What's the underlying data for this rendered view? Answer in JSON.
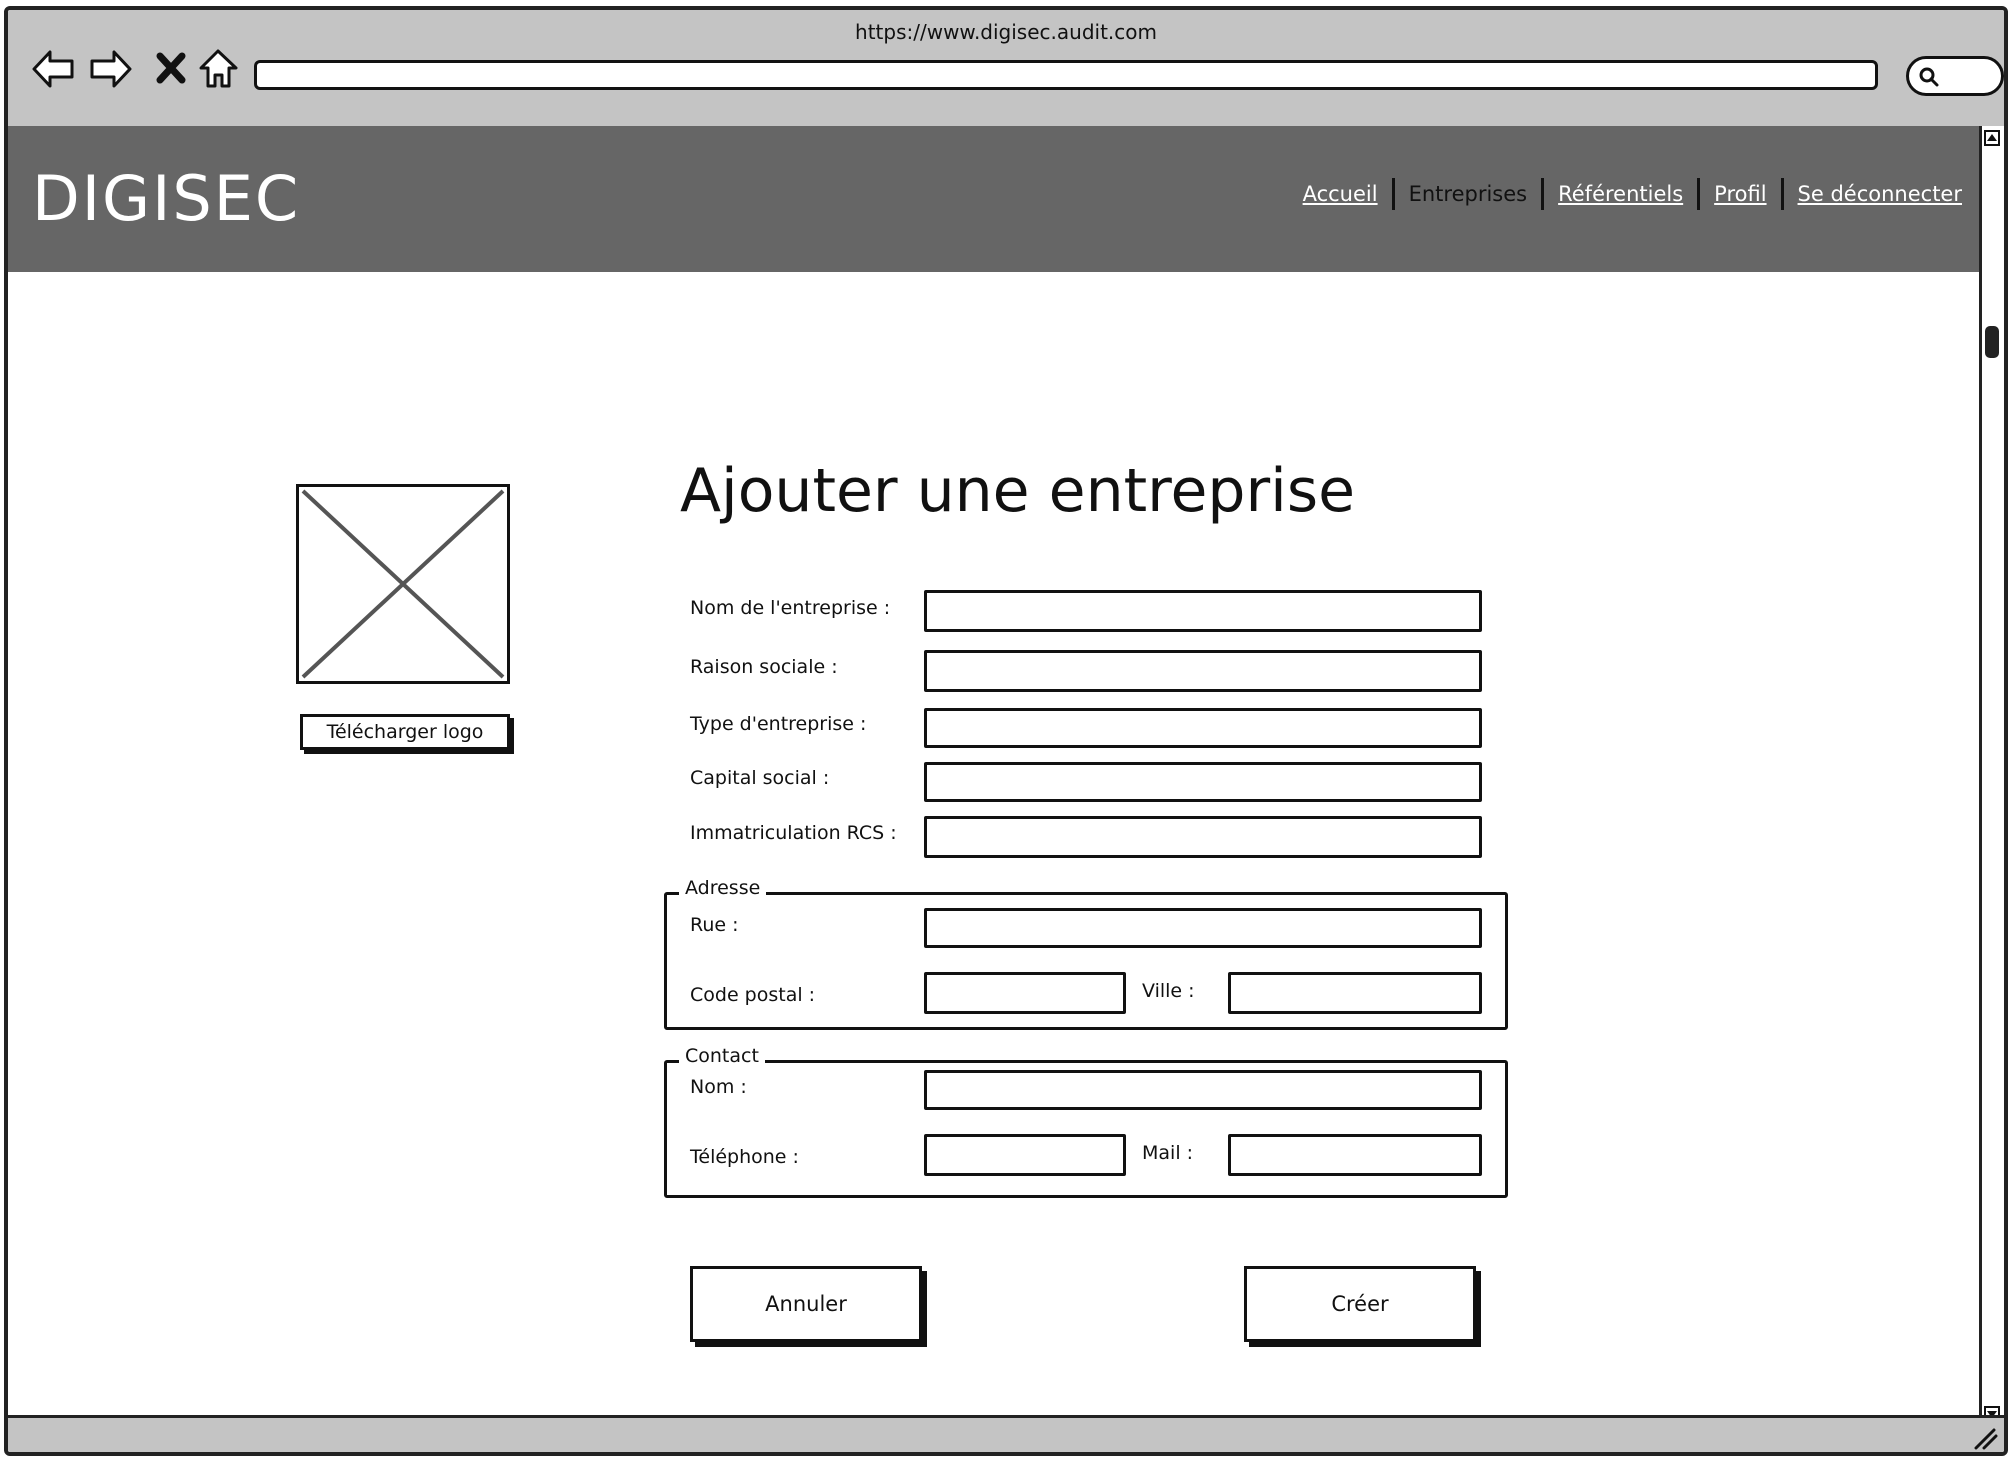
{
  "browser": {
    "url": "https://www.digisec.audit.com"
  },
  "header": {
    "logo": "DIGISEC",
    "nav": [
      {
        "label": "Accueil"
      },
      {
        "label": "Entreprises"
      },
      {
        "label": "Référentiels"
      },
      {
        "label": "Profil"
      },
      {
        "label": "Se déconnecter"
      }
    ],
    "active": "Entreprises"
  },
  "sidebar": {
    "upload_label": "Télécharger logo"
  },
  "form": {
    "title": "Ajouter une entreprise",
    "fields": {
      "name": {
        "label": "Nom de l'entreprise :",
        "value": ""
      },
      "raison": {
        "label": "Raison sociale :",
        "value": ""
      },
      "type": {
        "label": "Type d'entreprise :",
        "value": ""
      },
      "capital": {
        "label": "Capital social :",
        "value": ""
      },
      "rcs": {
        "label": "Immatriculation RCS :",
        "value": ""
      }
    },
    "address": {
      "legend": "Adresse",
      "street_label": "Rue :",
      "postal_label": "Code postal :",
      "city_label": "Ville :"
    },
    "contact": {
      "legend": "Contact",
      "name_label": "Nom :",
      "phone_label": "Téléphone :",
      "mail_label": "Mail :"
    },
    "cancel_label": "Annuler",
    "create_label": "Créer"
  },
  "icons": {
    "back": "back-arrow-icon",
    "forward": "forward-arrow-icon",
    "stop": "close-icon",
    "home": "home-icon",
    "search": "search-icon",
    "image_placeholder": "image-placeholder-icon"
  }
}
